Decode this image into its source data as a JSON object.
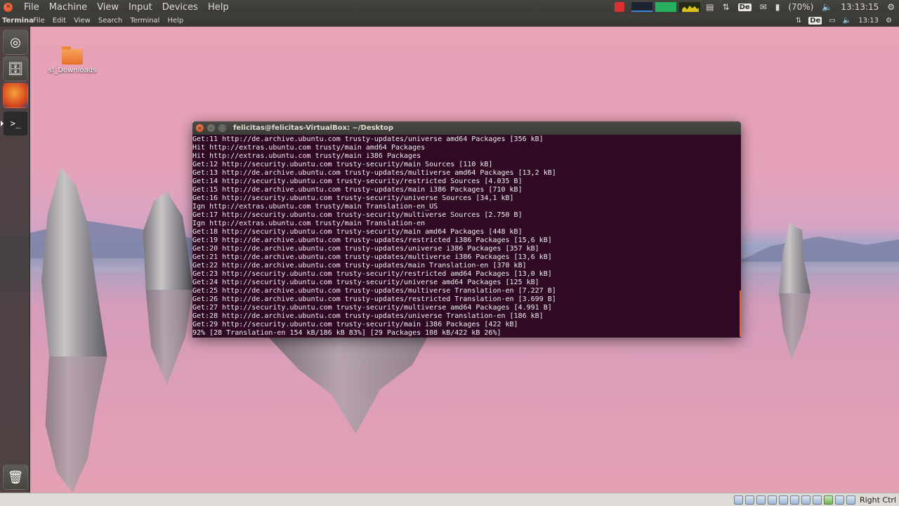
{
  "host_bar": {
    "menus": [
      "File",
      "Machine",
      "View",
      "Input",
      "Devices",
      "Help"
    ],
    "keyboard_layout": "De",
    "battery": "(70%)",
    "clock": "13:13:15"
  },
  "guest_bar": {
    "app_name": "Terminal",
    "menus": [
      "File",
      "Edit",
      "View",
      "Search",
      "Terminal",
      "Help"
    ],
    "keyboard_layout": "De",
    "clock": "13:13"
  },
  "desktop": {
    "folder_label": "sf_Downloads"
  },
  "terminal": {
    "title": "felicitas@felicitas-VirtualBox: ~/Desktop",
    "lines": [
      "Get:11 http://de.archive.ubuntu.com trusty-updates/universe amd64 Packages [356 kB]",
      "Hit http://extras.ubuntu.com trusty/main amd64 Packages",
      "Hit http://extras.ubuntu.com trusty/main i386 Packages",
      "Get:12 http://security.ubuntu.com trusty-security/main Sources [110 kB]",
      "Get:13 http://de.archive.ubuntu.com trusty-updates/multiverse amd64 Packages [13,2 kB]",
      "Get:14 http://security.ubuntu.com trusty-security/restricted Sources [4.035 B]",
      "Get:15 http://de.archive.ubuntu.com trusty-updates/main i386 Packages [710 kB]",
      "Get:16 http://security.ubuntu.com trusty-security/universe Sources [34,1 kB]",
      "Ign http://extras.ubuntu.com trusty/main Translation-en_US",
      "Get:17 http://security.ubuntu.com trusty-security/multiverse Sources [2.750 B]",
      "Ign http://extras.ubuntu.com trusty/main Translation-en",
      "Get:18 http://security.ubuntu.com trusty-security/main amd64 Packages [448 kB]",
      "Get:19 http://de.archive.ubuntu.com trusty-updates/restricted i386 Packages [15,6 kB]",
      "Get:20 http://de.archive.ubuntu.com trusty-updates/universe i386 Packages [357 kB]",
      "Get:21 http://de.archive.ubuntu.com trusty-updates/multiverse i386 Packages [13,6 kB]",
      "Get:22 http://de.archive.ubuntu.com trusty-updates/main Translation-en [370 kB]",
      "Get:23 http://security.ubuntu.com trusty-security/restricted amd64 Packages [13,0 kB]",
      "Get:24 http://security.ubuntu.com trusty-security/universe amd64 Packages [125 kB]",
      "Get:25 http://de.archive.ubuntu.com trusty-updates/multiverse Translation-en [7.227 B]",
      "Get:26 http://de.archive.ubuntu.com trusty-updates/restricted Translation-en [3.699 B]",
      "Get:27 http://security.ubuntu.com trusty-security/multiverse amd64 Packages [4.991 B]",
      "Get:28 http://de.archive.ubuntu.com trusty-updates/universe Translation-en [186 kB]",
      "Get:29 http://security.ubuntu.com trusty-security/main i386 Packages [422 kB]",
      "92% [28 Translation-en 154 kB/186 kB 83%] [29 Packages 108 kB/422 kB 26%]"
    ]
  },
  "vbox_status": {
    "host_key": "Right Ctrl"
  },
  "colors": {
    "terminal_bg": "#300a24",
    "accent_orange": "#e2622a"
  }
}
